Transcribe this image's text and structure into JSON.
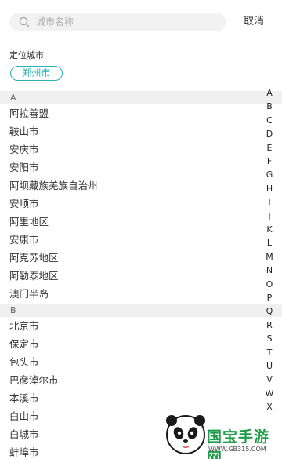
{
  "search": {
    "placeholder": "城市名称",
    "cancel_label": "取消"
  },
  "location": {
    "title": "定位城市",
    "city": "郑州市"
  },
  "sections": [
    {
      "letter": "A",
      "cities": [
        "阿拉善盟",
        "鞍山市",
        "安庆市",
        "安阳市",
        "阿坝藏族羌族自治州",
        "安顺市",
        "阿里地区",
        "安康市",
        "阿克苏地区",
        "阿勒泰地区",
        "澳门半岛"
      ]
    },
    {
      "letter": "B",
      "cities": [
        "北京市",
        "保定市",
        "包头市",
        "巴彦淖尔市",
        "本溪市",
        "白山市",
        "白城市",
        "蚌埠市"
      ]
    }
  ],
  "index_letters": [
    "A",
    "B",
    "C",
    "D",
    "E",
    "F",
    "G",
    "H",
    "I",
    "J",
    "K",
    "L",
    "M",
    "N",
    "O",
    "P",
    "Q",
    "R",
    "S",
    "T",
    "U",
    "V",
    "W",
    "X"
  ],
  "watermark": {
    "brand": "国宝手游网",
    "url": "WWW.GB315.COM"
  },
  "colors": {
    "accent": "#2bb3b1",
    "section_bg": "#f0f0f0",
    "brand_green": "#1e9b4b"
  }
}
